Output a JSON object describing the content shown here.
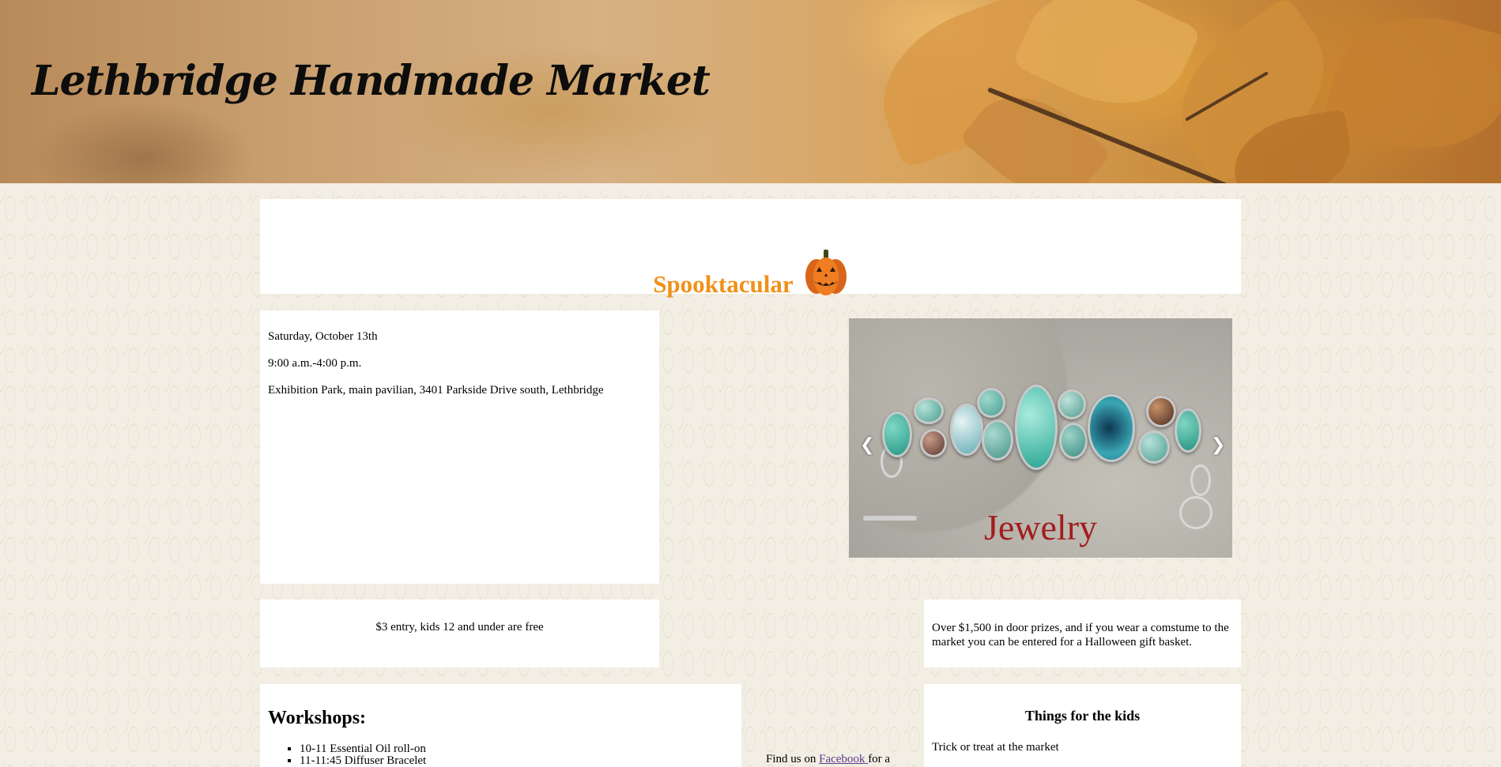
{
  "header": {
    "site_title": "Lethbridge Handmade Market"
  },
  "event": {
    "title": "Spooktacular",
    "icon": "pumpkin-icon",
    "title_color": "#f0901a",
    "date": "Saturday, October 13th",
    "time": "9:00 a.m.-4:00 p.m.",
    "location": "Exhibition Park, main pavilian, 3401 Parkside Drive south, Lethbridge"
  },
  "carousel": {
    "caption": "Jewelry",
    "caption_color": "#a21d1d",
    "prev_icon": "chevron-left-icon",
    "next_icon": "chevron-right-icon"
  },
  "entry": {
    "text": "$3 entry, kids 12 and under are free"
  },
  "prizes": {
    "text": "Over $1,500 in door prizes, and if you wear a comstume to the market you can be entered for a Halloween gift basket."
  },
  "workshops": {
    "heading": "Workshops:",
    "items": [
      "10-11 Essential Oil roll-on",
      "11-11:45 Diffuser Bracelet"
    ]
  },
  "social": {
    "prefix": "Find us on ",
    "link_label": "Facebook ",
    "suffix": "for a"
  },
  "kids": {
    "heading": "Things for the kids",
    "items": [
      "Trick or treat at the market"
    ]
  }
}
